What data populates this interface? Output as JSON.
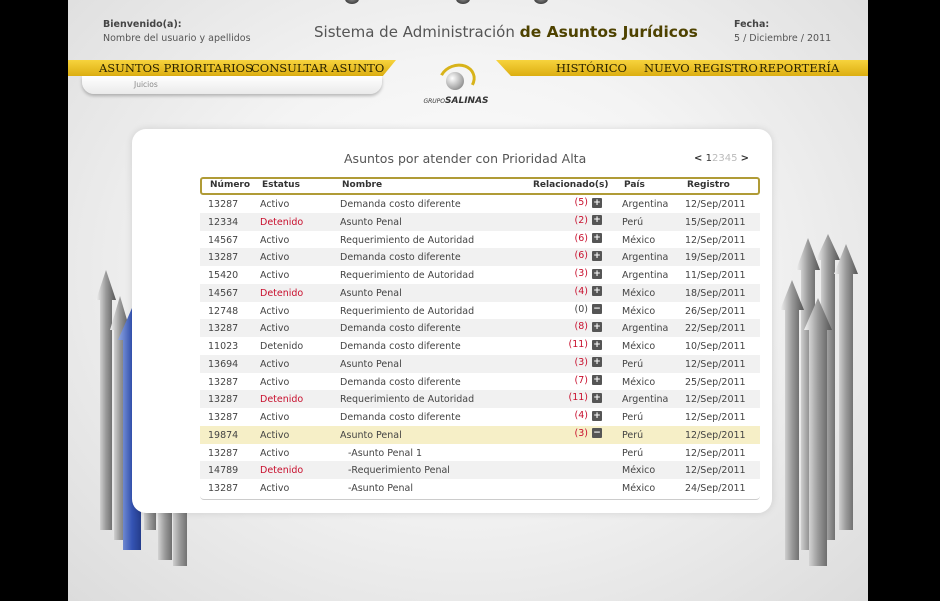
{
  "header": {
    "welcome_label": "Bienvenido(a):",
    "user_name": "Nombre del usuario y apellidos",
    "title_plain": "Sistema de Administración",
    "title_bold": "de Asuntos Jurídicos",
    "date_label": "Fecha:",
    "date_value": "5 / Diciembre / 2011"
  },
  "nav": {
    "left": [
      "ASUNTOS PRIORITARIOS",
      "CONSULTAR ASUNTO"
    ],
    "right": [
      "HISTÓRICO",
      "NUEVO REGISTRO",
      "REPORTERÍA"
    ],
    "submenu": [
      "Juicios"
    ]
  },
  "logo": {
    "prefix": "GRUPO",
    "name": "SALINAS"
  },
  "colors": {
    "accent": "#e7bf22",
    "status_red": "#c8102e",
    "highlight_row": "#f6efc7"
  },
  "panel": {
    "title": "Asuntos por atender con Prioridad Alta",
    "pager": {
      "prev": "<",
      "current": "1",
      "pages": [
        "2",
        "3",
        "4",
        "5"
      ],
      "next": ">"
    }
  },
  "table": {
    "columns": [
      "Número",
      "Estatus",
      "Nombre",
      "Relacionado(s)",
      "País",
      "Registro"
    ],
    "rows": [
      {
        "numero": "13287",
        "estatus": "Activo",
        "nombre": "Demanda costo diferente",
        "rel": "(5)",
        "toggle": "+",
        "pais": "Argentina",
        "registro": "12/Sep/2011"
      },
      {
        "numero": "12334",
        "estatus": "Detenido",
        "nombre": "Asunto Penal",
        "rel": "(2)",
        "toggle": "+",
        "pais": "Perú",
        "registro": "15/Sep/2011"
      },
      {
        "numero": "14567",
        "estatus": "Activo",
        "nombre": "Requerimiento de Autoridad",
        "rel": "(6)",
        "toggle": "+",
        "pais": "México",
        "registro": "12/Sep/2011"
      },
      {
        "numero": "13287",
        "estatus": "Activo",
        "nombre": "Demanda costo diferente",
        "rel": "(6)",
        "toggle": "+",
        "pais": "Argentina",
        "registro": "19/Sep/2011"
      },
      {
        "numero": "15420",
        "estatus": "Activo",
        "nombre": "Requerimiento de Autoridad",
        "rel": "(3)",
        "toggle": "+",
        "pais": "Argentina",
        "registro": "11/Sep/2011"
      },
      {
        "numero": "14567",
        "estatus": "Detenido",
        "nombre": "Asunto Penal",
        "rel": "(4)",
        "toggle": "+",
        "pais": "México",
        "registro": "18/Sep/2011"
      },
      {
        "numero": "12748",
        "estatus": "Activo",
        "nombre": "Requerimiento de Autoridad",
        "rel": "(0)",
        "toggle": "−",
        "pais": "México",
        "registro": "26/Sep/2011"
      },
      {
        "numero": "13287",
        "estatus": "Activo",
        "nombre": "Demanda costo diferente",
        "rel": "(8)",
        "toggle": "+",
        "pais": "Argentina",
        "registro": "22/Sep/2011"
      },
      {
        "numero": "11023",
        "estatus": "Detenido",
        "nombre": "Demanda costo diferente",
        "rel": "(11)",
        "toggle": "+",
        "pais": "México",
        "registro": "10/Sep/2011"
      },
      {
        "numero": "13694",
        "estatus": "Activo",
        "nombre": "Asunto Penal",
        "rel": "(3)",
        "toggle": "+",
        "pais": "Perú",
        "registro": "12/Sep/2011"
      },
      {
        "numero": "13287",
        "estatus": "Activo",
        "nombre": "Demanda costo diferente",
        "rel": "(7)",
        "toggle": "+",
        "pais": "México",
        "registro": "25/Sep/2011"
      },
      {
        "numero": "13287",
        "estatus": "Detenido",
        "nombre": "Requerimiento de Autoridad",
        "rel": "(11)",
        "toggle": "+",
        "pais": "Argentina",
        "registro": "12/Sep/2011"
      },
      {
        "numero": "13287",
        "estatus": "Activo",
        "nombre": "Demanda costo diferente",
        "rel": "(4)",
        "toggle": "+",
        "pais": "Perú",
        "registro": "12/Sep/2011"
      },
      {
        "numero": "19874",
        "estatus": "Activo",
        "nombre": "Asunto Penal",
        "rel": "(3)",
        "toggle": "−",
        "pais": "Perú",
        "registro": "12/Sep/2011"
      },
      {
        "numero": "13287",
        "estatus": "Activo",
        "nombre": "-Asunto Penal 1",
        "rel": "",
        "toggle": "",
        "pais": "Perú",
        "registro": "12/Sep/2011"
      },
      {
        "numero": "14789",
        "estatus": "Detenido",
        "nombre": "-Requerimiento Penal",
        "rel": "",
        "toggle": "",
        "pais": "México",
        "registro": "12/Sep/2011"
      },
      {
        "numero": "13287",
        "estatus": "Activo",
        "nombre": "-Asunto Penal",
        "rel": "",
        "toggle": "",
        "pais": "México",
        "registro": "24/Sep/2011"
      }
    ]
  }
}
